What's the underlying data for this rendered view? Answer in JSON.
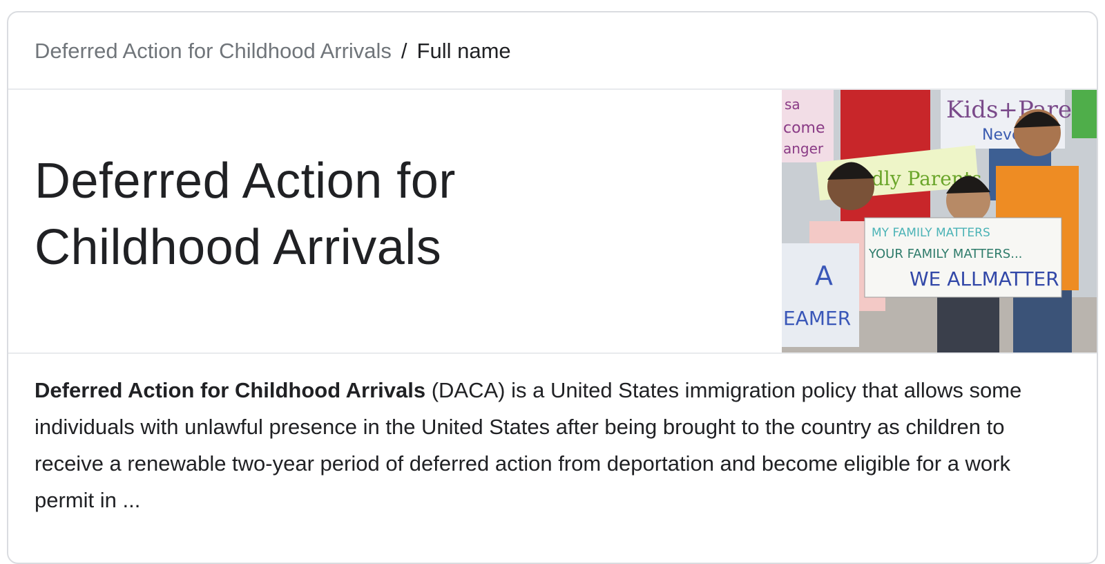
{
  "breadcrumb": {
    "parent": "Deferred Action for Childhood Arrivals",
    "separator": "/",
    "current": "Full name"
  },
  "hero": {
    "title_line1": "Deferred Action for",
    "title_line2": "Childhood Arrivals",
    "image": {
      "sign_left_1": "sa",
      "sign_left_2": "come",
      "sign_left_3": "anger",
      "sign_top_right": "Kids+Parents",
      "sign_top_right_2": "Never",
      "sign_green": "dly Parents",
      "sign_main_line1": "MY FAMILY MATTERS",
      "sign_main_line2": "YOUR FAMILY MATTERS...",
      "sign_main_line3": "WE ALLMATTER",
      "sign_small_1": "A",
      "sign_small_2": "EAMER"
    }
  },
  "description": {
    "bold_lead": "Deferred Action for Childhood Arrivals",
    "text": " (DACA) is a United States immigration policy that allows some individuals with unlawful presence in the United States after being brought to the country as children to receive a renewable two-year period of deferred action from deportation and become eligible for a work permit in ..."
  },
  "colors": {
    "border": "#dadce0",
    "muted_text": "#70757a",
    "text": "#202124"
  }
}
